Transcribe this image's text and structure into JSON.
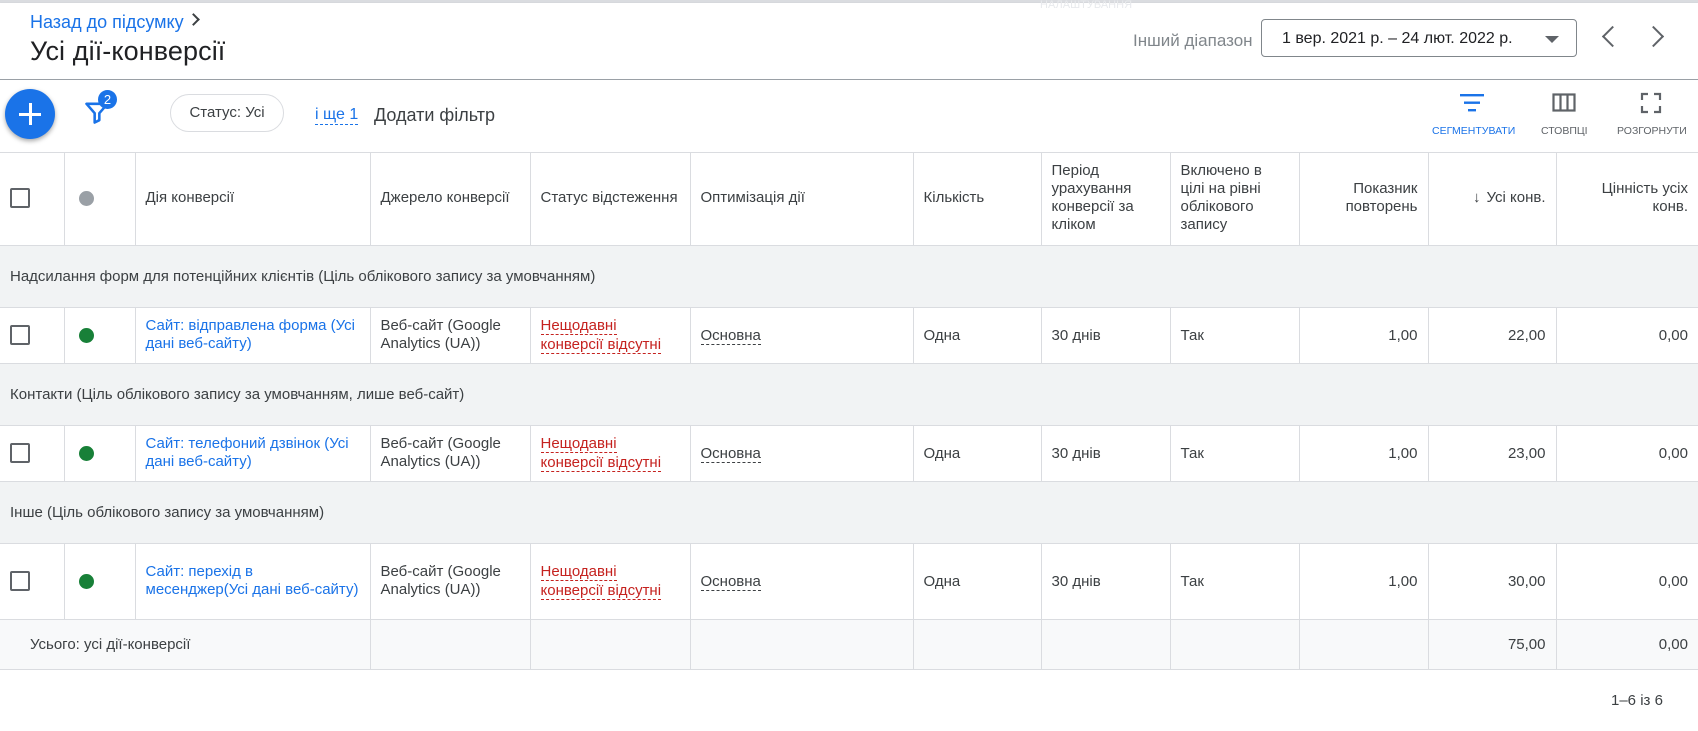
{
  "header": {
    "back_link": "Назад до підсумку",
    "title": "Усі дії-конверсії",
    "ghost_text": "НАЛАШТУВАННЯ",
    "range_label": "Інший діапазон",
    "date_range": "1 вер. 2021 р. – 24 лют. 2022 р."
  },
  "toolbar": {
    "filter_count": "2",
    "status_chip": "Статус: Усі",
    "more_filters": "і ще 1",
    "add_filter": "Додати фільтр",
    "segment_label": "СЕГМЕНТУВАТИ",
    "columns_label": "СТОВПЦІ",
    "expand_label": "РОЗГОРНУТИ"
  },
  "colors": {
    "accent": "#1a73e8",
    "status_ok": "#188038",
    "warning": "#c5221f"
  },
  "table": {
    "columns": {
      "action": "Дія конверсії",
      "source": "Джерело конверсії",
      "tracking": "Статус відстеження",
      "optimization": "Оптимізація дії",
      "count": "Кількість",
      "window": "Період урахування конверсії за кліком",
      "included": "Включено в цілі на рівні облікового запису",
      "repeat_rate": "Показник повторень",
      "all_conv": "Усі конв.",
      "all_value": "Цінність усіх конв."
    },
    "groups": [
      {
        "title": "Надсилання форм для потенційних клієнтів (Ціль облікового запису за умовчанням)",
        "row": {
          "action": "Сайт: відправлена форма (Усі дані веб-сайту)",
          "source": "Веб-сайт (Google Analytics (UA))",
          "tracking_1": "Нещодавні",
          "tracking_2": "конверсії відсутні",
          "optimization": "Основна",
          "count": "Одна",
          "window": "30 днів",
          "included": "Так",
          "repeat_rate": "1,00",
          "all_conv": "22,00",
          "all_value": "0,00"
        }
      },
      {
        "title": "Контакти (Ціль облікового запису за умовчанням, лише веб-сайт)",
        "row": {
          "action": "Сайт: телефоний дзвінок (Усі дані веб-сайту)",
          "source": "Веб-сайт (Google Analytics (UA))",
          "tracking_1": "Нещодавні",
          "tracking_2": "конверсії відсутні",
          "optimization": "Основна",
          "count": "Одна",
          "window": "30 днів",
          "included": "Так",
          "repeat_rate": "1,00",
          "all_conv": "23,00",
          "all_value": "0,00"
        }
      },
      {
        "title": "Інше (Ціль облікового запису за умовчанням)",
        "row": {
          "action": "Сайт: перехід в месенджер(Усі дані веб-сайту)",
          "source": "Веб-сайт (Google Analytics (UA))",
          "tracking_1": "Нещодавні",
          "tracking_2": "конверсії відсутні",
          "optimization": "Основна",
          "count": "Одна",
          "window": "30 днів",
          "included": "Так",
          "repeat_rate": "1,00",
          "all_conv": "30,00",
          "all_value": "0,00"
        }
      }
    ],
    "total": {
      "label": "Усього: усі дії-конверсії",
      "all_conv": "75,00",
      "all_value": "0,00"
    }
  },
  "pager": "1–6 із 6"
}
